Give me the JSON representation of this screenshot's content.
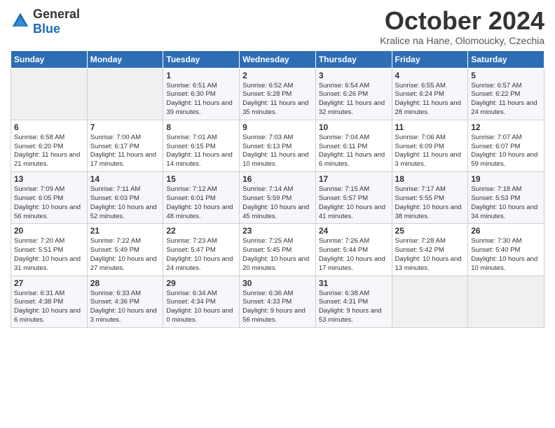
{
  "header": {
    "logo_general": "General",
    "logo_blue": "Blue",
    "month_title": "October 2024",
    "location": "Kralice na Hane, Olomoucky, Czechia"
  },
  "weekdays": [
    "Sunday",
    "Monday",
    "Tuesday",
    "Wednesday",
    "Thursday",
    "Friday",
    "Saturday"
  ],
  "weeks": [
    [
      {
        "day": "",
        "detail": ""
      },
      {
        "day": "",
        "detail": ""
      },
      {
        "day": "1",
        "detail": "Sunrise: 6:51 AM\nSunset: 6:30 PM\nDaylight: 11 hours and 39 minutes."
      },
      {
        "day": "2",
        "detail": "Sunrise: 6:52 AM\nSunset: 6:28 PM\nDaylight: 11 hours and 35 minutes."
      },
      {
        "day": "3",
        "detail": "Sunrise: 6:54 AM\nSunset: 6:26 PM\nDaylight: 11 hours and 32 minutes."
      },
      {
        "day": "4",
        "detail": "Sunrise: 6:55 AM\nSunset: 6:24 PM\nDaylight: 11 hours and 28 minutes."
      },
      {
        "day": "5",
        "detail": "Sunrise: 6:57 AM\nSunset: 6:22 PM\nDaylight: 11 hours and 24 minutes."
      }
    ],
    [
      {
        "day": "6",
        "detail": "Sunrise: 6:58 AM\nSunset: 6:20 PM\nDaylight: 11 hours and 21 minutes."
      },
      {
        "day": "7",
        "detail": "Sunrise: 7:00 AM\nSunset: 6:17 PM\nDaylight: 11 hours and 17 minutes."
      },
      {
        "day": "8",
        "detail": "Sunrise: 7:01 AM\nSunset: 6:15 PM\nDaylight: 11 hours and 14 minutes."
      },
      {
        "day": "9",
        "detail": "Sunrise: 7:03 AM\nSunset: 6:13 PM\nDaylight: 11 hours and 10 minutes."
      },
      {
        "day": "10",
        "detail": "Sunrise: 7:04 AM\nSunset: 6:11 PM\nDaylight: 11 hours and 6 minutes."
      },
      {
        "day": "11",
        "detail": "Sunrise: 7:06 AM\nSunset: 6:09 PM\nDaylight: 11 hours and 3 minutes."
      },
      {
        "day": "12",
        "detail": "Sunrise: 7:07 AM\nSunset: 6:07 PM\nDaylight: 10 hours and 59 minutes."
      }
    ],
    [
      {
        "day": "13",
        "detail": "Sunrise: 7:09 AM\nSunset: 6:05 PM\nDaylight: 10 hours and 56 minutes."
      },
      {
        "day": "14",
        "detail": "Sunrise: 7:11 AM\nSunset: 6:03 PM\nDaylight: 10 hours and 52 minutes."
      },
      {
        "day": "15",
        "detail": "Sunrise: 7:12 AM\nSunset: 6:01 PM\nDaylight: 10 hours and 48 minutes."
      },
      {
        "day": "16",
        "detail": "Sunrise: 7:14 AM\nSunset: 5:59 PM\nDaylight: 10 hours and 45 minutes."
      },
      {
        "day": "17",
        "detail": "Sunrise: 7:15 AM\nSunset: 5:57 PM\nDaylight: 10 hours and 41 minutes."
      },
      {
        "day": "18",
        "detail": "Sunrise: 7:17 AM\nSunset: 5:55 PM\nDaylight: 10 hours and 38 minutes."
      },
      {
        "day": "19",
        "detail": "Sunrise: 7:18 AM\nSunset: 5:53 PM\nDaylight: 10 hours and 34 minutes."
      }
    ],
    [
      {
        "day": "20",
        "detail": "Sunrise: 7:20 AM\nSunset: 5:51 PM\nDaylight: 10 hours and 31 minutes."
      },
      {
        "day": "21",
        "detail": "Sunrise: 7:22 AM\nSunset: 5:49 PM\nDaylight: 10 hours and 27 minutes."
      },
      {
        "day": "22",
        "detail": "Sunrise: 7:23 AM\nSunset: 5:47 PM\nDaylight: 10 hours and 24 minutes."
      },
      {
        "day": "23",
        "detail": "Sunrise: 7:25 AM\nSunset: 5:45 PM\nDaylight: 10 hours and 20 minutes."
      },
      {
        "day": "24",
        "detail": "Sunrise: 7:26 AM\nSunset: 5:44 PM\nDaylight: 10 hours and 17 minutes."
      },
      {
        "day": "25",
        "detail": "Sunrise: 7:28 AM\nSunset: 5:42 PM\nDaylight: 10 hours and 13 minutes."
      },
      {
        "day": "26",
        "detail": "Sunrise: 7:30 AM\nSunset: 5:40 PM\nDaylight: 10 hours and 10 minutes."
      }
    ],
    [
      {
        "day": "27",
        "detail": "Sunrise: 6:31 AM\nSunset: 4:38 PM\nDaylight: 10 hours and 6 minutes."
      },
      {
        "day": "28",
        "detail": "Sunrise: 6:33 AM\nSunset: 4:36 PM\nDaylight: 10 hours and 3 minutes."
      },
      {
        "day": "29",
        "detail": "Sunrise: 6:34 AM\nSunset: 4:34 PM\nDaylight: 10 hours and 0 minutes."
      },
      {
        "day": "30",
        "detail": "Sunrise: 6:36 AM\nSunset: 4:33 PM\nDaylight: 9 hours and 56 minutes."
      },
      {
        "day": "31",
        "detail": "Sunrise: 6:38 AM\nSunset: 4:31 PM\nDaylight: 9 hours and 53 minutes."
      },
      {
        "day": "",
        "detail": ""
      },
      {
        "day": "",
        "detail": ""
      }
    ]
  ]
}
